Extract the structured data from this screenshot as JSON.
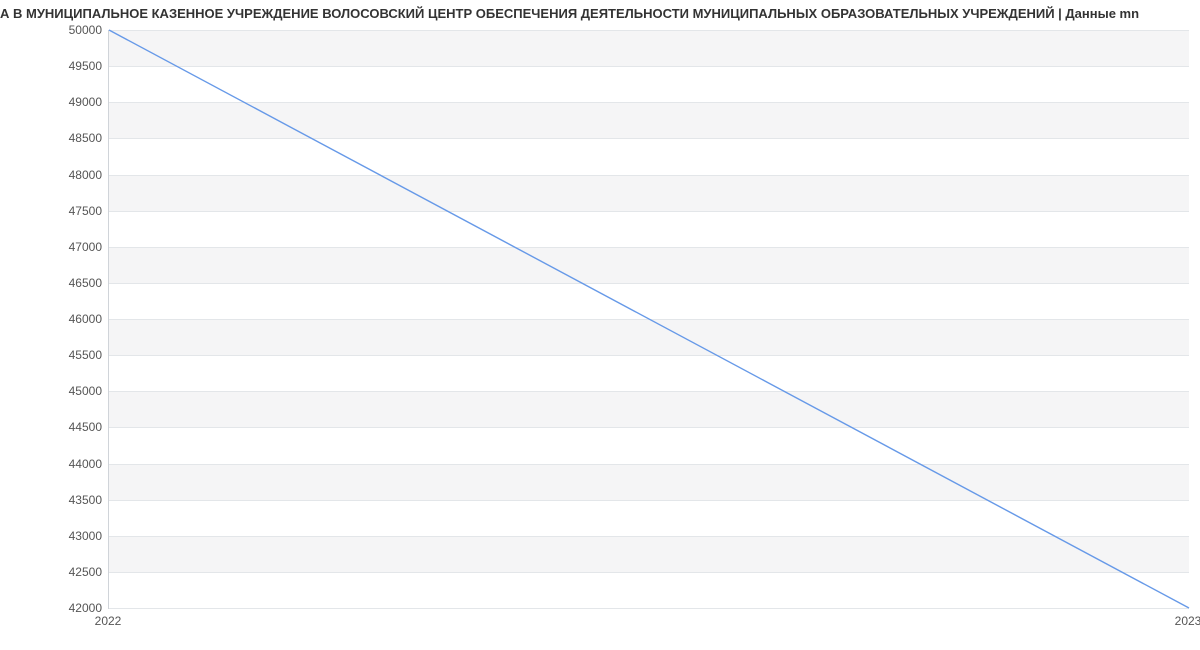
{
  "chart_data": {
    "type": "line",
    "title": "А В МУНИЦИПАЛЬНОЕ КАЗЕННОЕ УЧРЕЖДЕНИЕ ВОЛОСОВСКИЙ ЦЕНТР ОБЕСПЕЧЕНИЯ ДЕЯТЕЛЬНОСТИ МУНИЦИПАЛЬНЫХ ОБРАЗОВАТЕЛЬНЫХ УЧРЕЖДЕНИЙ | Данные mn",
    "x": [
      2022,
      2023
    ],
    "series": [
      {
        "name": "",
        "values": [
          50000,
          42000
        ],
        "color": "#6699e8"
      }
    ],
    "xlabel": "",
    "ylabel": "",
    "ylim": [
      42000,
      50000
    ],
    "yticks": [
      42000,
      42500,
      43000,
      43500,
      44000,
      44500,
      45000,
      45500,
      46000,
      46500,
      47000,
      47500,
      48000,
      48500,
      49000,
      49500,
      50000
    ],
    "xticks": [
      2022,
      2023
    ],
    "grid": true
  }
}
